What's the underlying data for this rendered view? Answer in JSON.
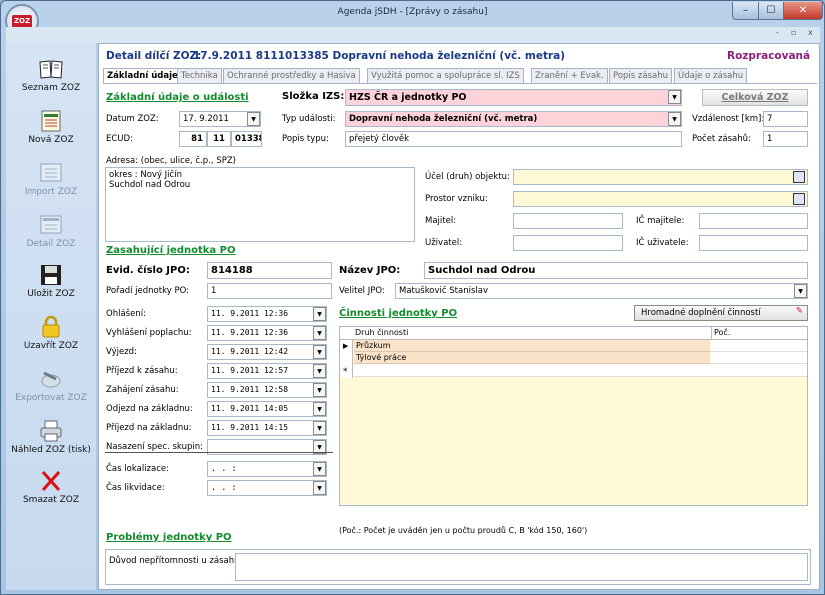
{
  "window": {
    "title": "Agenda jSDH - [Zprávy o zásahu]",
    "logo": "ZOZ",
    "min": "–",
    "max": "☐",
    "close": "✕"
  },
  "mdi": {
    "min": "-",
    "restore": "▫",
    "close": "x"
  },
  "sidebar": [
    {
      "label": "Seznam ZOZ",
      "icon": "book-icon",
      "enabled": true
    },
    {
      "label": "Nová ZOZ",
      "icon": "new-document-icon",
      "enabled": true
    },
    {
      "label": "Import ZOZ",
      "icon": "import-icon",
      "enabled": false
    },
    {
      "label": "Detail ZOZ",
      "icon": "detail-icon",
      "enabled": false
    },
    {
      "label": "Uložit ZOZ",
      "icon": "floppy-disk-icon",
      "enabled": true
    },
    {
      "label": "Uzavřít ZOZ",
      "icon": "lock-icon",
      "enabled": true
    },
    {
      "label": "Exportovat ZOZ",
      "icon": "export-icon",
      "enabled": false
    },
    {
      "label": "Náhled ZOZ (tisk)",
      "icon": "printer-icon",
      "enabled": true
    },
    {
      "label": "Smazat ZOZ",
      "icon": "delete-x-icon",
      "enabled": true
    }
  ],
  "header": {
    "prefix": "Detail dílčí ZOZ:",
    "title": "17.9.2011 8111013385 Dopravní nehoda železniční (vč. metra)",
    "status": "Rozpracovaná"
  },
  "tabs": [
    "Základní údaje",
    "Technika",
    "Ochranné prostředky a Hasiva",
    "Využitá pomoc a spolupráce sl. IZS",
    "Zranění + Evak.",
    "Popis zásahu",
    "Údaje o zásahu"
  ],
  "basic": {
    "section": "Základní údaje o události",
    "slozka_label": "Složka IZS:",
    "slozka": "HZS ČR a jednotky PO",
    "btn_celkova": "Celková ZOZ",
    "datum_label": "Datum ZOZ:",
    "datum": "17. 9.2011",
    "typ_label": "Typ události:",
    "typ": "Dopravní nehoda  železniční (vč. metra)",
    "vzdalenost_label": "Vzdálenost [km]:",
    "vzdalenost": "7",
    "ecud_label": "ECUD:",
    "ecud1": "81",
    "ecud2": "11",
    "ecud3": "013385",
    "popis_label": "Popis typu:",
    "popis": "přejetý člověk",
    "pocet_label": "Počet zásahů:",
    "pocet": "1",
    "adresa_label": "Adresa: (obec, ulice, č.p., SPZ)",
    "adresa1": "okres : Nový Jičín",
    "adresa2": "Suchdol nad Odrou",
    "ucel_label": "Účel (druh) objektu:",
    "prostor_label": "Prostor vzniku:",
    "majitel_label": "Majitel:",
    "ic_majitele_label": "IČ majitele:",
    "uzivatel_label": "Uživatel:",
    "ic_uzivatele_label": "IČ uživatele:"
  },
  "unit": {
    "section": "Zasahující jednotka PO",
    "evid_label": "Evid. číslo JPO:",
    "evid": "814188",
    "nazev_label": "Název JPO:",
    "nazev": "Suchdol nad Odrou",
    "poradi_label": "Pořadí jednotky PO:",
    "poradi": "1",
    "velitel_label": "Velitel JPO:",
    "velitel": "Matuškovič Stanislav",
    "times": [
      {
        "label": "Ohlášení:",
        "value": "11. 9.2011 12:36"
      },
      {
        "label": "Vyhlášení poplachu:",
        "value": "11. 9.2011 12:36"
      },
      {
        "label": "Výjezd:",
        "value": "11. 9.2011 12:42"
      },
      {
        "label": "Příjezd k zásahu:",
        "value": "11. 9.2011 12:57"
      },
      {
        "label": "Zahájení zásahu:",
        "value": "11. 9.2011 12:58"
      },
      {
        "label": "Odjezd na základnu:",
        "value": "11. 9.2011 14:05"
      },
      {
        "label": "Příjezd na základnu:",
        "value": "11. 9.2011 14:15"
      },
      {
        "label": "Nasazení spec. skupin:",
        "value": ""
      }
    ],
    "lokalizace_label": "Čas lokalizace:",
    "lokalizace": "  .    .          :",
    "likvidace_label": "Čas likvidace:",
    "likvidace": "  .    .          :"
  },
  "activities": {
    "section": "Činnosti jednotky PO",
    "btn": "Hromadné doplnění činností",
    "col1": "Druh činnosti",
    "col2": "Poč.",
    "rows": [
      "Průzkum",
      "Týlové práce"
    ],
    "new_marker": "*",
    "cur_marker": "▶",
    "note": "(Poč.: Počet je uváděn jen u počtu proudů C, B 'kód 150, 160')"
  },
  "problems": {
    "section": "Problémy jednotky PO",
    "duvod_label": "Důvod nepřítomnosti u zásahu:"
  }
}
